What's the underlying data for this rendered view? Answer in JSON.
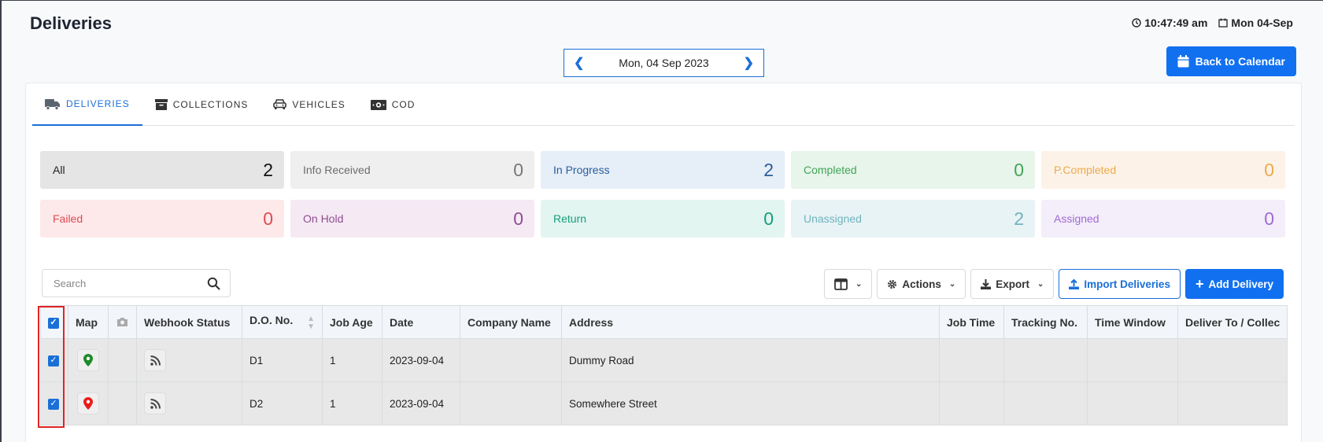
{
  "header": {
    "title": "Deliveries",
    "time": "10:47:49 am",
    "date": "Mon 04-Sep"
  },
  "date_nav": {
    "current": "Mon, 04 Sep 2023",
    "prev_icon": "chevron-left-icon",
    "next_icon": "chevron-right-icon"
  },
  "back_button": {
    "label": "Back to Calendar",
    "icon": "calendar-icon"
  },
  "tabs": [
    {
      "label": "DELIVERIES",
      "icon": "truck-icon",
      "active": true
    },
    {
      "label": "COLLECTIONS",
      "icon": "archive-icon",
      "active": false
    },
    {
      "label": "VEHICLES",
      "icon": "car-icon",
      "active": false
    },
    {
      "label": "COD",
      "icon": "money-icon",
      "active": false
    }
  ],
  "stats": [
    {
      "label": "All",
      "count": "2",
      "bg": "#e5e5e5",
      "fg": "#222222",
      "numfg": "#111111"
    },
    {
      "label": "Info Received",
      "count": "0",
      "bg": "#efefef",
      "fg": "#6c6c6c",
      "numfg": "#777777"
    },
    {
      "label": "In Progress",
      "count": "2",
      "bg": "#e6eef8",
      "fg": "#2a5d9a",
      "numfg": "#2a5d9a"
    },
    {
      "label": "Completed",
      "count": "0",
      "bg": "#e7f5ea",
      "fg": "#43a457",
      "numfg": "#43a457"
    },
    {
      "label": "P.Completed",
      "count": "0",
      "bg": "#fdf2e7",
      "fg": "#ecaa4e",
      "numfg": "#ecaa4e"
    },
    {
      "label": "Failed",
      "count": "0",
      "bg": "#fde9ea",
      "fg": "#e04a53",
      "numfg": "#e04a53"
    },
    {
      "label": "On Hold",
      "count": "0",
      "bg": "#f5e9f4",
      "fg": "#8e4d92",
      "numfg": "#8e4d92"
    },
    {
      "label": "Return",
      "count": "0",
      "bg": "#e3f5f0",
      "fg": "#149f7c",
      "numfg": "#149f7c"
    },
    {
      "label": "Unassigned",
      "count": "2",
      "bg": "#e8f3f5",
      "fg": "#6fb3bd",
      "numfg": "#6fb3bd"
    },
    {
      "label": "Assigned",
      "count": "0",
      "bg": "#f3eefa",
      "fg": "#a16ad6",
      "numfg": "#a16ad6"
    }
  ],
  "search": {
    "placeholder": "Search"
  },
  "toolbar": {
    "columns_icon": "columns-icon",
    "actions_label": "Actions",
    "export_label": "Export",
    "import_label": "Import Deliveries",
    "add_label": "Add Delivery"
  },
  "table": {
    "headers": [
      "",
      "Map",
      "",
      "Webhook Status",
      "D.O. No.",
      "Job Age",
      "Date",
      "Company Name",
      "Address",
      "Job Time",
      "Tracking No.",
      "Time Window",
      "Deliver To / Collec"
    ],
    "rows": [
      {
        "checked": true,
        "pin_color": "#1e8a2a",
        "do_no": "D1",
        "job_age": "1",
        "date": "2023-09-04",
        "company": "",
        "address": "Dummy Road",
        "job_time": "",
        "tracking": "",
        "time_window": "",
        "deliver_to": ""
      },
      {
        "checked": true,
        "pin_color": "#e81c1c",
        "do_no": "D2",
        "job_age": "1",
        "date": "2023-09-04",
        "company": "",
        "address": "Somewhere Street",
        "job_time": "",
        "tracking": "",
        "time_window": "",
        "deliver_to": ""
      }
    ]
  }
}
